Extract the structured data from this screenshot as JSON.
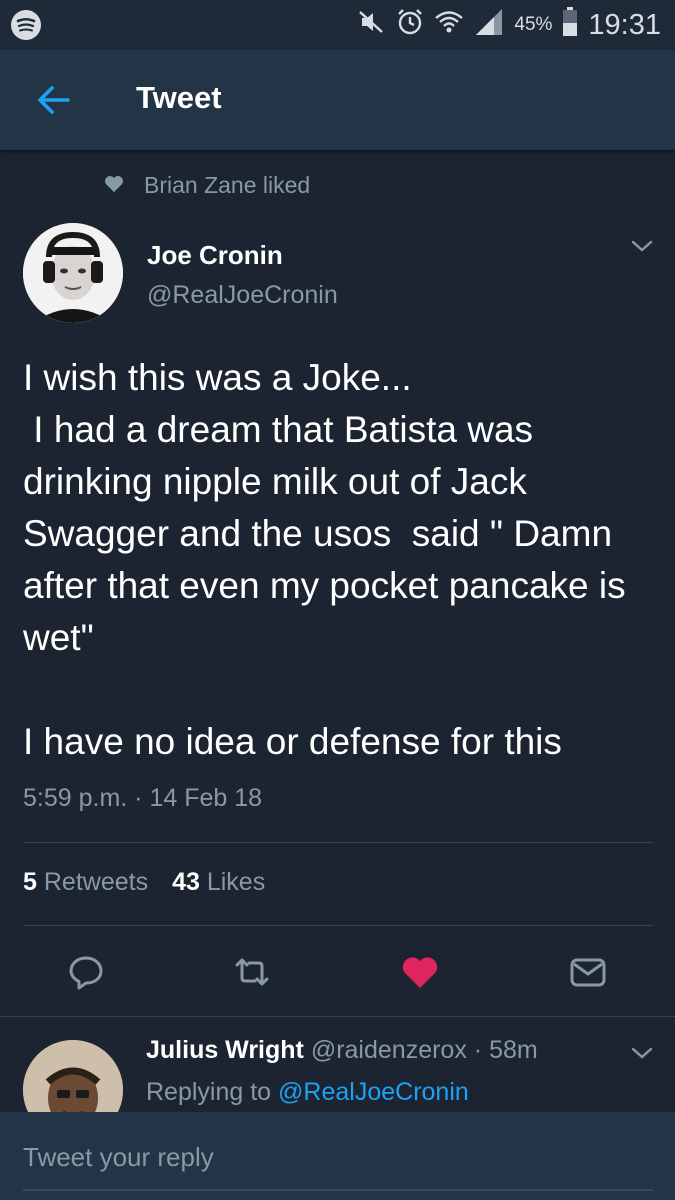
{
  "status_bar": {
    "battery_percent": "45%",
    "time": "19:31",
    "icons": [
      "spotify-icon",
      "mute-icon",
      "alarm-icon",
      "wifi-icon",
      "signal-icon",
      "battery-icon"
    ]
  },
  "app_bar": {
    "title": "Tweet",
    "back_icon": "back-arrow-icon",
    "accent_color": "#1da1f2"
  },
  "social_context": {
    "icon": "heart-icon",
    "text": "Brian Zane liked"
  },
  "tweet": {
    "author_name": "Joe Cronin",
    "author_handle": "@RealJoeCronin",
    "text": "I wish this was a Joke...\n I had a dream that Batista was drinking nipple milk out of Jack Swagger and the usos  said \" Damn after that even my pocket pancake is wet\"\n\nI have no idea or defense for this",
    "timestamp": "5:59 p.m. · 14 Feb 18",
    "retweets_count": "5",
    "retweets_label": "Retweets",
    "likes_count": "43",
    "likes_label": "Likes",
    "liked": true,
    "like_color": "#e0245e"
  },
  "actions": [
    "reply-icon",
    "retweet-icon",
    "like-icon",
    "message-icon"
  ],
  "reply": {
    "author_name": "Julius Wright",
    "author_handle": "@raidenzerox",
    "age": "· 58m",
    "replying_label": "Replying to",
    "replying_to": "@RealJoeCronin"
  },
  "compose": {
    "placeholder": "Tweet your reply"
  }
}
